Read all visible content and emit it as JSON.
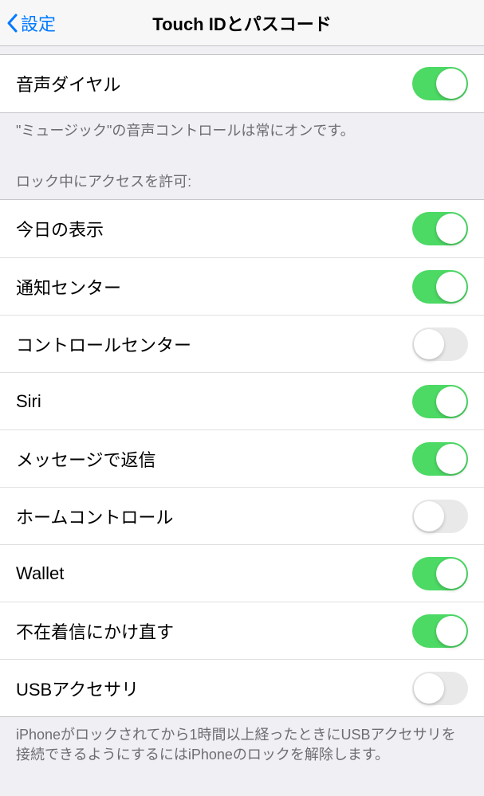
{
  "nav": {
    "back_label": "設定",
    "title": "Touch IDとパスコード"
  },
  "section1": {
    "voice_dial_label": "音声ダイヤル",
    "voice_dial_on": true,
    "footer": "\"ミュージック\"の音声コントロールは常にオンです。"
  },
  "section2": {
    "header": "ロック中にアクセスを許可:",
    "items": [
      {
        "label": "今日の表示",
        "on": true
      },
      {
        "label": "通知センター",
        "on": true
      },
      {
        "label": "コントロールセンター",
        "on": false
      },
      {
        "label": "Siri",
        "on": true
      },
      {
        "label": "メッセージで返信",
        "on": true
      },
      {
        "label": "ホームコントロール",
        "on": false
      },
      {
        "label": "Wallet",
        "on": true
      },
      {
        "label": "不在着信にかけ直す",
        "on": true
      },
      {
        "label": "USBアクセサリ",
        "on": false
      }
    ],
    "footer": "iPhoneがロックされてから1時間以上経ったときにUSBアクセサリを接続できるようにするにはiPhoneのロックを解除します。"
  }
}
